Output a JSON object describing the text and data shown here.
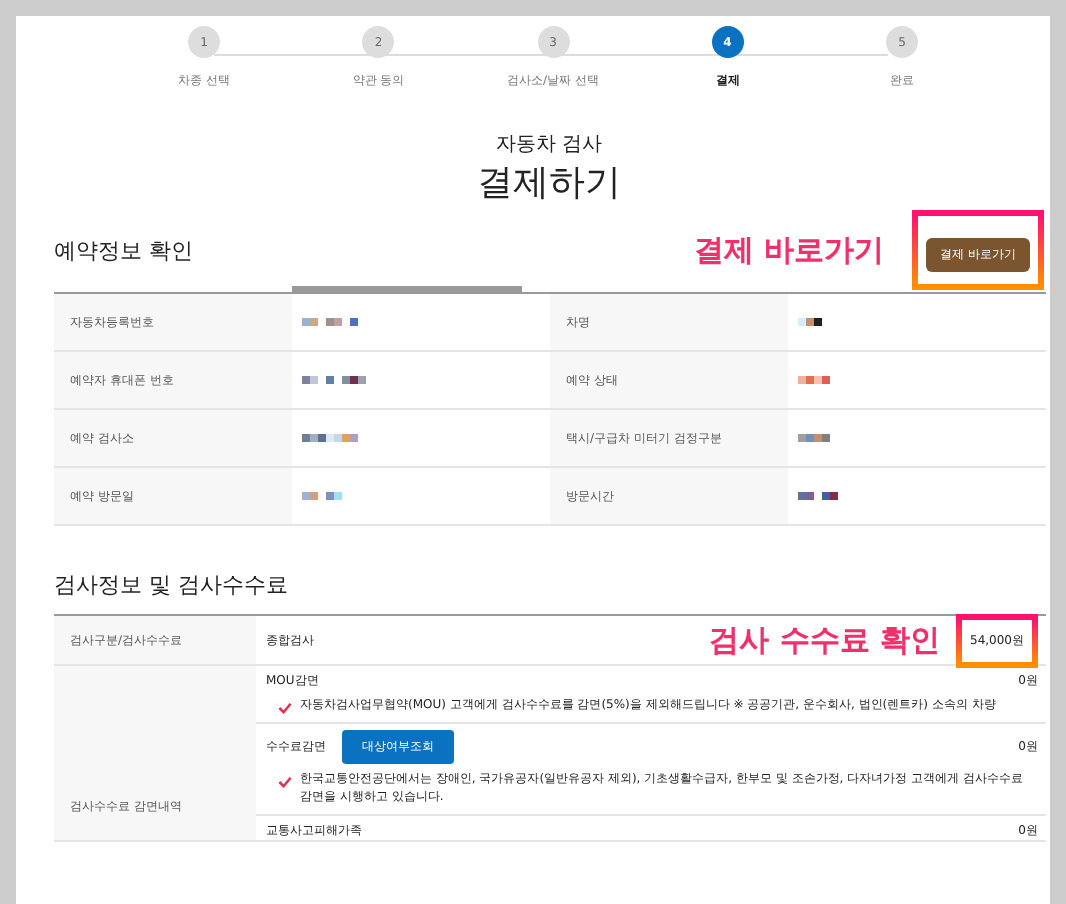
{
  "steps": [
    {
      "number": "1",
      "label": "차종 선택",
      "selected": false
    },
    {
      "number": "2",
      "label": "약관 동의",
      "selected": false
    },
    {
      "number": "3",
      "label": "검사소/날짜 선택",
      "selected": false
    },
    {
      "number": "4",
      "label": "결제",
      "selected": true
    },
    {
      "number": "5",
      "label": "완료",
      "selected": false
    }
  ],
  "page": {
    "subtitle": "자동차 검사",
    "title": "결제하기"
  },
  "reservation": {
    "heading": "예약정보 확인",
    "shortcut_button": "결제 바로가기",
    "callout": "결제 바로가기",
    "rows": [
      {
        "label_1": "자동차등록번호",
        "label_2": "차명"
      },
      {
        "label_1": "예약자 휴대폰 번호",
        "label_2": "예약 상태"
      },
      {
        "label_1": "예약 검사소",
        "label_2": "택시/구급차 미터기 검정구분"
      },
      {
        "label_1": "예약 방문일",
        "label_2": "방문시간"
      }
    ]
  },
  "inspection": {
    "heading": "검사정보 및 검사수수료",
    "callout": "검사 수수료 확인",
    "fee_row": {
      "label": "검사구분/검사수수료",
      "type": "종합검사",
      "amount": "54,000원"
    },
    "discount_label": "검사수수료 감면내역",
    "discounts": [
      {
        "name": "MOU감면",
        "amount": "0원",
        "note": "자동차검사업무협약(MOU) 고객에게 검사수수료를 감면(5%)을 제외해드립니다 ※ 공공기관, 운수회사, 법인(렌트카) 소속의 차량"
      },
      {
        "name": "수수료감면",
        "button": "대상여부조회",
        "amount": "0원",
        "note": "한국교통안전공단에서는 장애인, 국가유공자(일반유공자 제외), 기초생활수급자, 한부모 및 조손가정, 다자녀가정 고객에게 검사수수료 감면을 시행하고 있습니다."
      },
      {
        "name": "교통사고피해가족",
        "amount": "0원"
      }
    ]
  }
}
